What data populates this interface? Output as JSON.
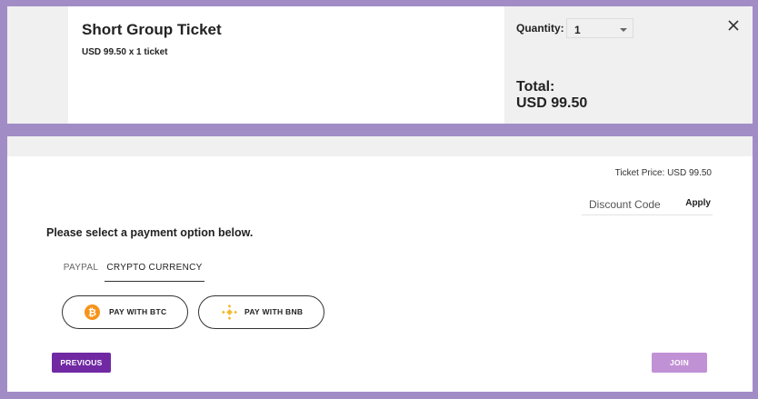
{
  "ticket": {
    "title": "Short Group Ticket",
    "subtitle": "USD 99.50 x 1 ticket",
    "quantity_label": "Quantity:",
    "quantity_value": "1",
    "total_label": "Total:",
    "total_value": "USD 99.50"
  },
  "payment": {
    "ticket_price": "Ticket Price: USD 99.50",
    "discount_placeholder": "Discount Code",
    "apply_label": "Apply",
    "prompt": "Please select a payment option below.",
    "tabs": [
      {
        "label": "PAYPAL",
        "active": false
      },
      {
        "label": "CRYPTO CURRENCY",
        "active": true
      }
    ],
    "options": [
      {
        "label": "PAY WITH BTC",
        "icon": "bitcoin-icon"
      },
      {
        "label": "PAY WITH BNB",
        "icon": "binance-icon"
      }
    ],
    "previous_label": "PREVIOUS",
    "join_label": "JOIN"
  },
  "colors": {
    "background": "#a18cc6",
    "primary": "#7029a3",
    "join_disabled": "#c191d6",
    "btc": "#f7931a",
    "bnb": "#f3ba2f"
  }
}
